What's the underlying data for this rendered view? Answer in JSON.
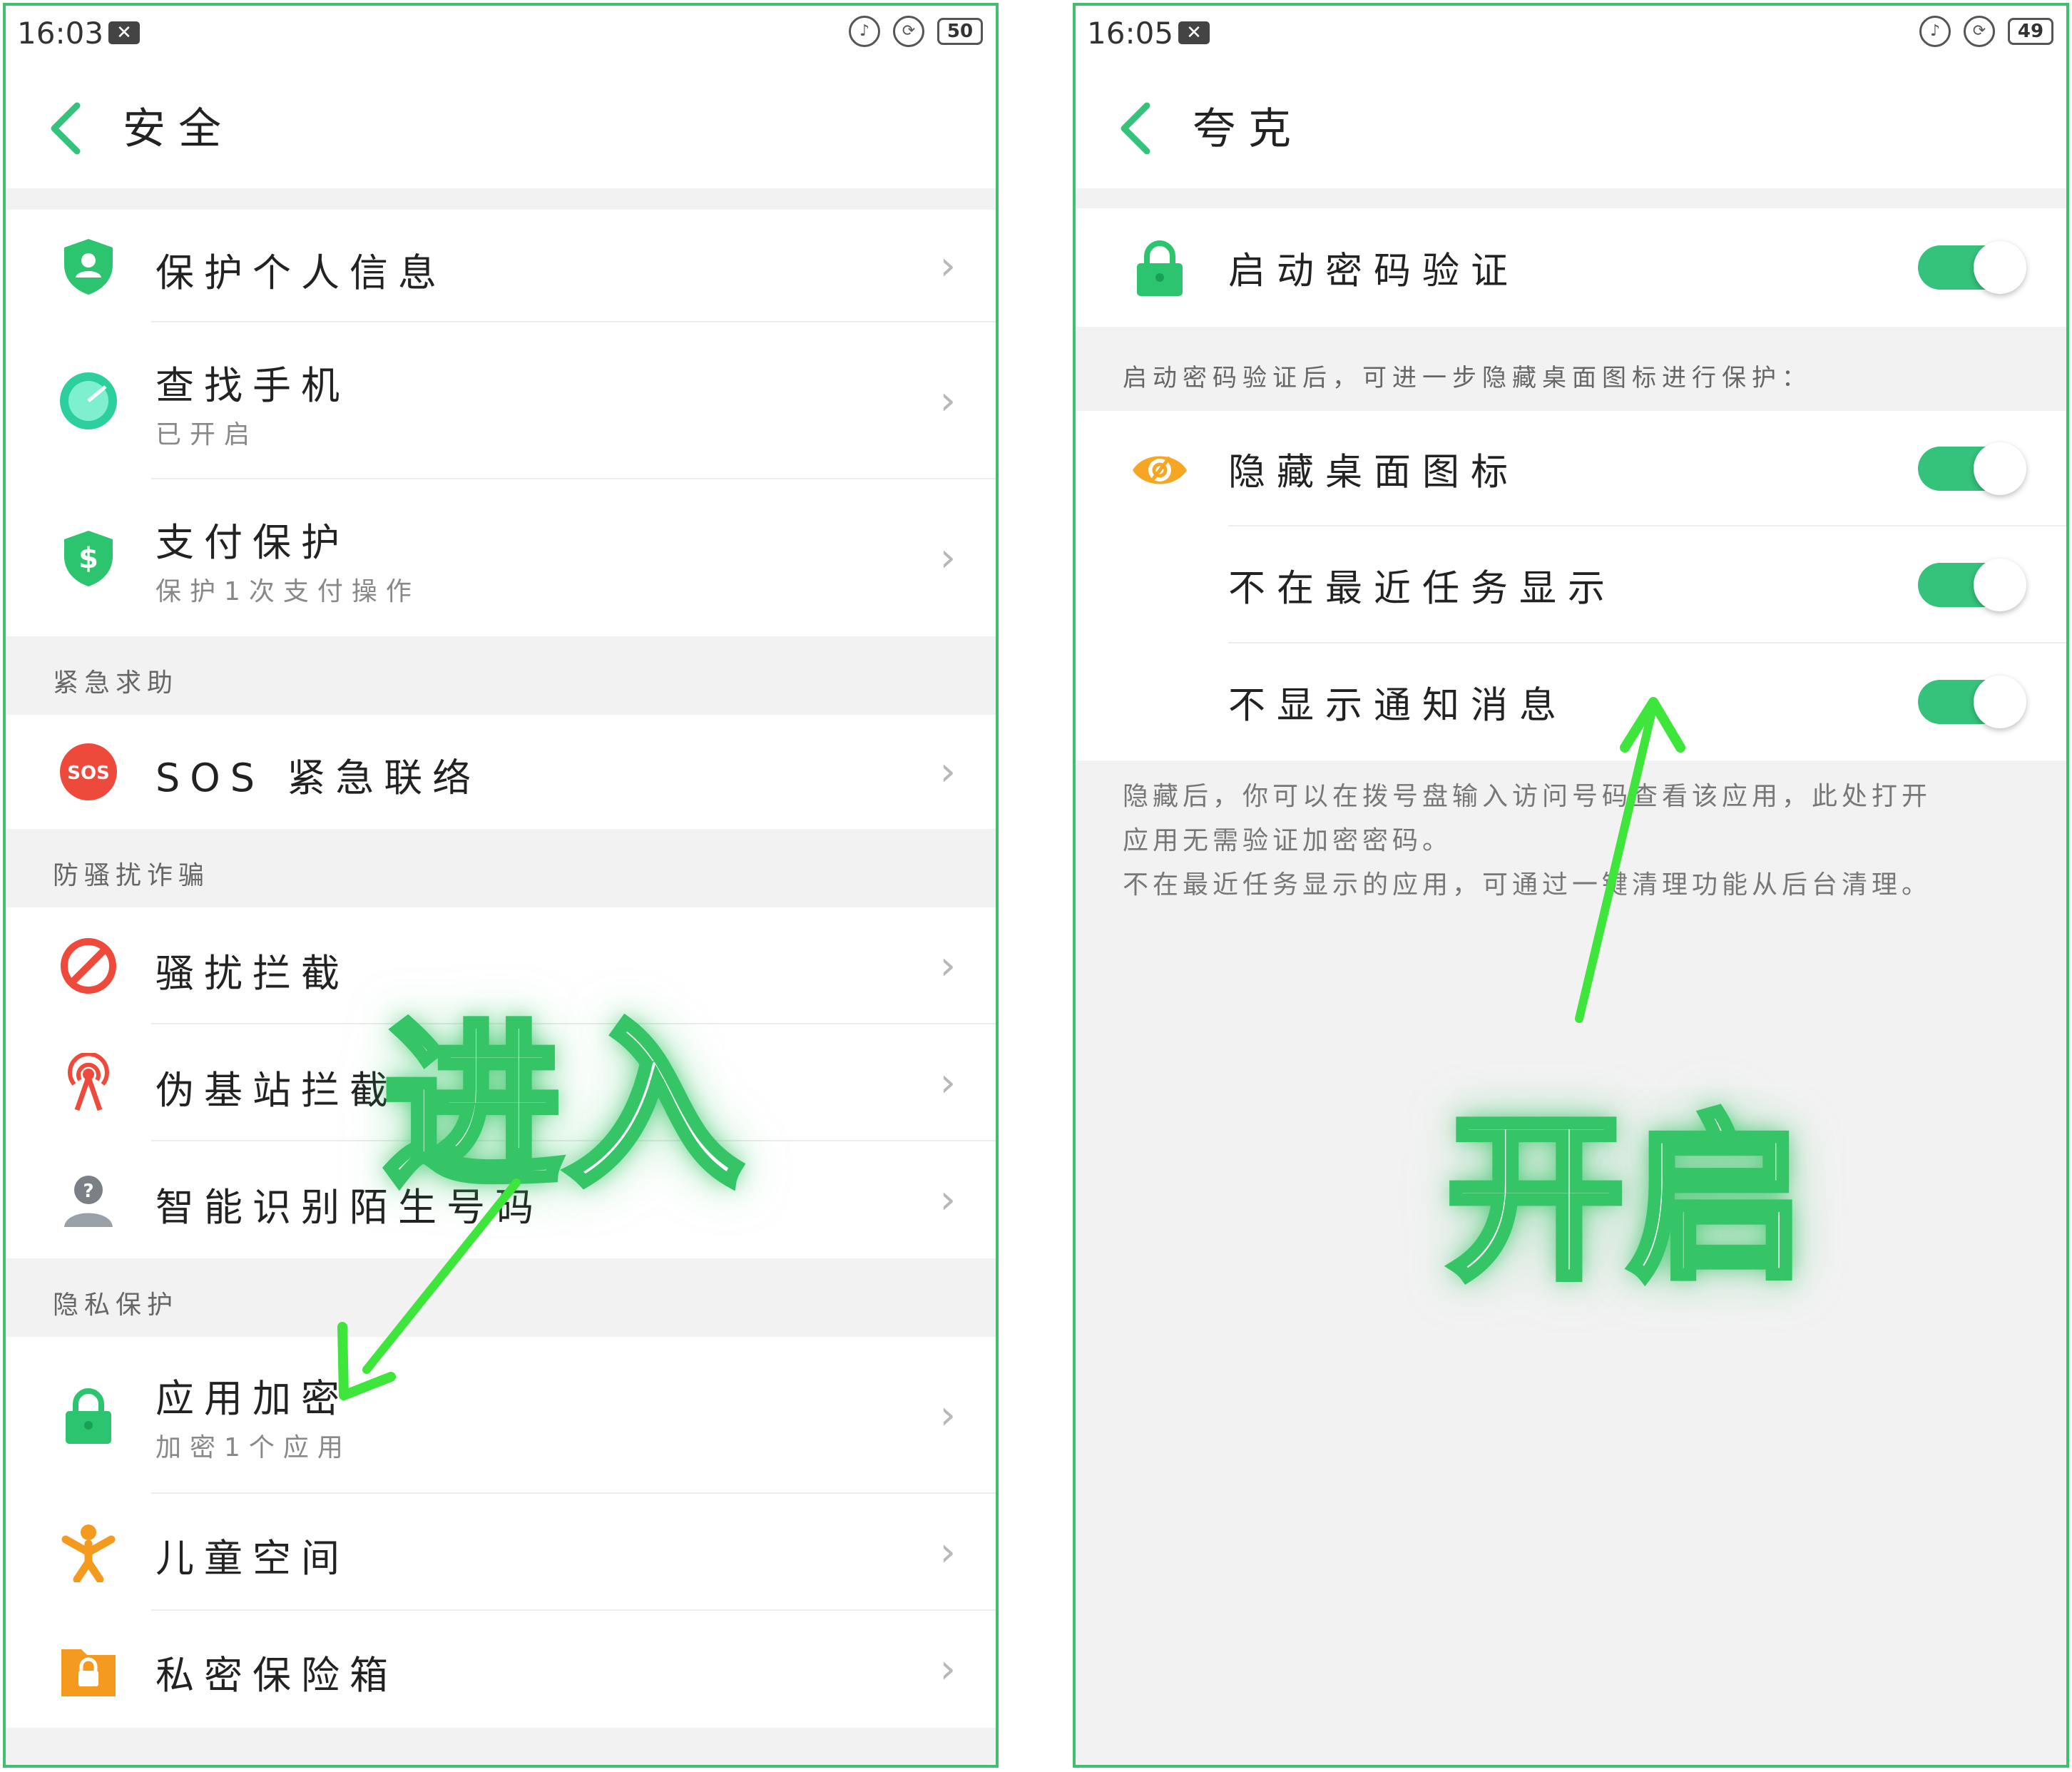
{
  "left": {
    "status": {
      "time": "16:03",
      "battery": "50"
    },
    "title": "安全",
    "rows1": [
      {
        "title": "保护个人信息",
        "sub": ""
      },
      {
        "title": "查找手机",
        "sub": "已开启"
      },
      {
        "title": "支付保护",
        "sub": "保护1次支付操作"
      }
    ],
    "header_emergency": "紧急求助",
    "sos_badge": "SOS",
    "sos_row": "SOS 紧急联络",
    "header_fraud": "防骚扰诈骗",
    "rows2": [
      "骚扰拦截",
      "伪基站拦截",
      "智能识别陌生号码"
    ],
    "header_privacy": "隐私保护",
    "rows3": [
      {
        "title": "应用加密",
        "sub": "加密1个应用"
      },
      {
        "title": "儿童空间",
        "sub": ""
      },
      {
        "title": "私密保险箱",
        "sub": ""
      }
    ],
    "chevron": "›",
    "overlay_text": "进入"
  },
  "right": {
    "status": {
      "time": "16:05",
      "battery": "49"
    },
    "title": "夸克",
    "password_row": "启动密码验证",
    "password_on": true,
    "hint": "启动密码验证后，可进一步隐藏桌面图标进行保护：",
    "toggles": [
      {
        "label": "隐藏桌面图标",
        "on": true
      },
      {
        "label": "不在最近任务显示",
        "on": true
      },
      {
        "label": "不显示通知消息",
        "on": true
      }
    ],
    "note_lines": [
      "隐藏后，你可以在拨号盘输入访问号码查看该应用，此处打开",
      "应用无需验证加密密码。",
      "不在最近任务显示的应用，可通过一键清理功能从后台清理。"
    ],
    "overlay_text": "开启"
  },
  "colors": {
    "accent": "#35c27a",
    "border": "#3fc06d",
    "arrow": "#3ee53b"
  },
  "icons": [
    "shield-user-icon",
    "find-phone-icon",
    "payment-shield-icon",
    "sos-icon",
    "block-icon",
    "antenna-icon",
    "unknown-caller-icon",
    "lock-icon",
    "child-icon",
    "safe-folder-icon",
    "hide-eye-icon",
    "back-chevron-icon",
    "vibrate-icon",
    "rotation-lock-icon",
    "battery-icon"
  ]
}
